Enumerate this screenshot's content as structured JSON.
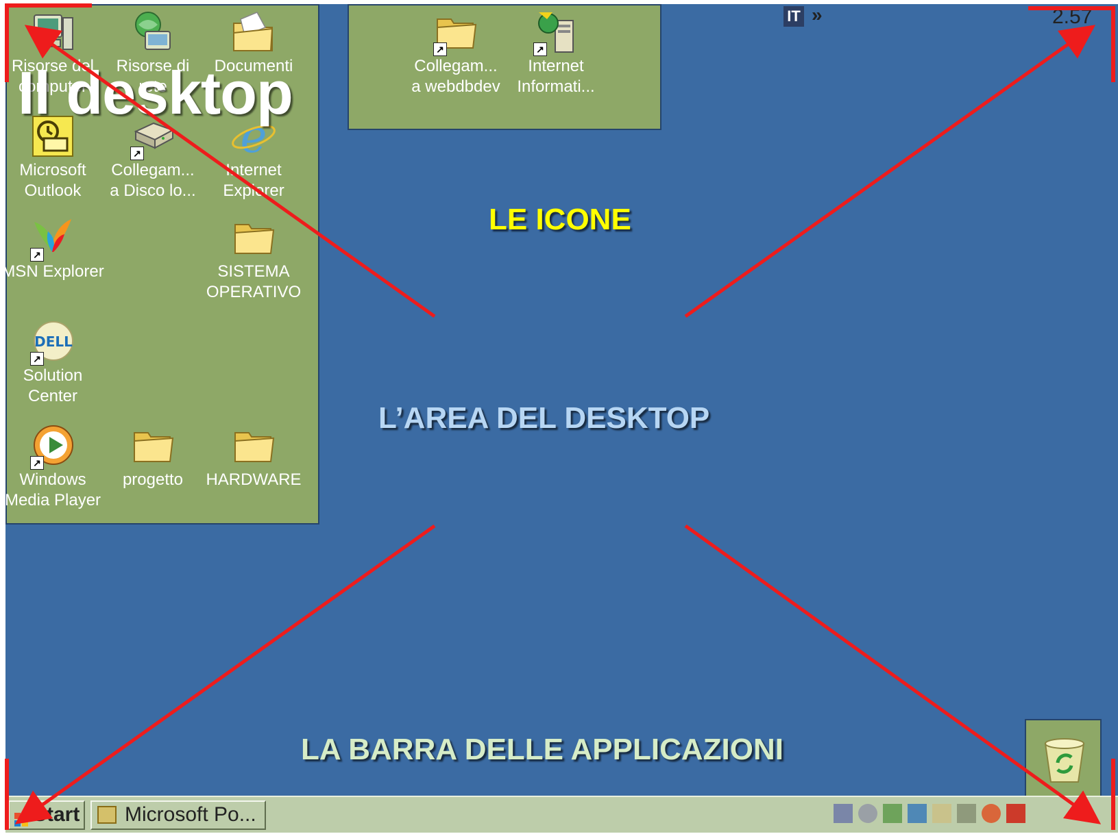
{
  "slide": {
    "title": "Il desktop",
    "callouts": {
      "icons": "LE ICONE",
      "desktop_area": "L’AREA DEL DESKTOP",
      "taskbar": "LA BARRA DELLE APPLICAZIONI"
    }
  },
  "desktop": {
    "left_icons": [
      {
        "label": "Risorse del\ncomputer",
        "icon": "my-computer-icon"
      },
      {
        "label": "Risorse di\nrete",
        "icon": "network-places-icon"
      },
      {
        "label": "Documenti",
        "icon": "my-documents-icon"
      },
      {
        "label": "Microsoft\nOutlook",
        "icon": "outlook-icon"
      },
      {
        "label": "Collegam...\na Disco lo...",
        "icon": "local-disk-shortcut-icon"
      },
      {
        "label": "Internet\nExplorer",
        "icon": "internet-explorer-icon"
      },
      {
        "label": "MSN Explorer",
        "icon": "msn-explorer-icon"
      },
      {
        "label": "SISTEMA\nOPERATIVO",
        "icon": "folder-icon"
      },
      {
        "label": "Solution\nCenter",
        "icon": "dell-solution-center-icon"
      },
      {
        "label": "Windows\nMedia Player",
        "icon": "windows-media-player-icon"
      },
      {
        "label": "progetto",
        "icon": "folder-icon"
      },
      {
        "label": "HARDWARE",
        "icon": "folder-icon"
      }
    ],
    "top_icons": [
      {
        "label": "Collegam...\na webdbdev",
        "icon": "folder-shortcut-icon"
      },
      {
        "label": "Internet\nInformati...",
        "icon": "iis-manager-icon"
      }
    ],
    "recycle_bin": {
      "icon": "recycle-bin-icon"
    }
  },
  "taskbar": {
    "start_label": "Start",
    "task_button_label": "Microsoft Po...",
    "language_indicator": "IT",
    "tray_chevron": "»",
    "clock": "2.57"
  },
  "colors": {
    "desktop_background": "#3b6ba3",
    "icon_panel_background": "#8ea867",
    "taskbar_background": "#bdcdaa",
    "arrow_color": "#ee1c1c",
    "icons_callout": "#ffff00",
    "desktop_area_callout": "#b7d6f3",
    "taskbar_callout": "#d6ecc7"
  }
}
